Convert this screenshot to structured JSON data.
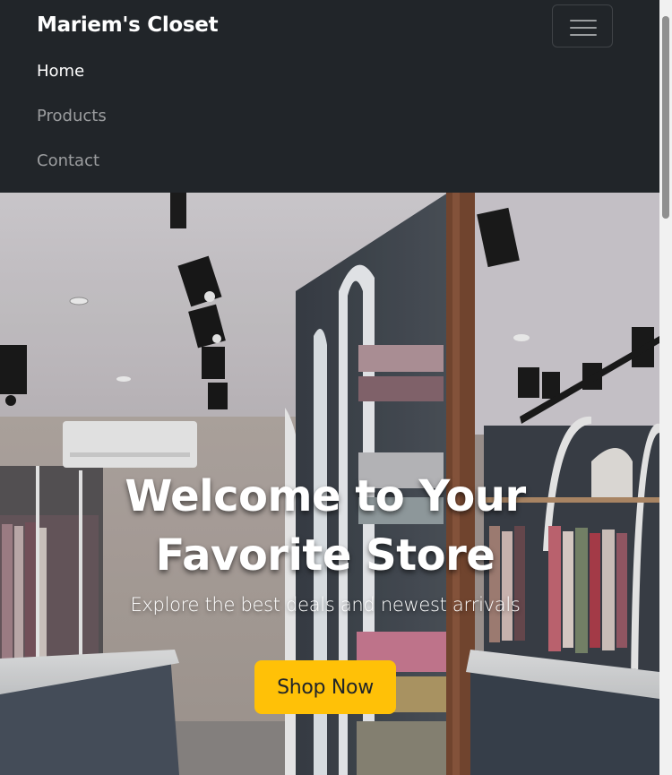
{
  "navbar": {
    "brand": "Mariem's Closet",
    "toggler_icon": "hamburger-menu-icon",
    "links": [
      {
        "label": "Home",
        "active": true
      },
      {
        "label": "Products",
        "active": false
      },
      {
        "label": "Contact",
        "active": false
      }
    ]
  },
  "hero": {
    "title": "Welcome to Your Favorite Store",
    "subtitle": "Explore the best deals and newest arrivals",
    "button_label": "Shop Now"
  },
  "colors": {
    "navbar_bg": "#212529",
    "accent": "#ffc107",
    "text_light": "#ffffff"
  }
}
